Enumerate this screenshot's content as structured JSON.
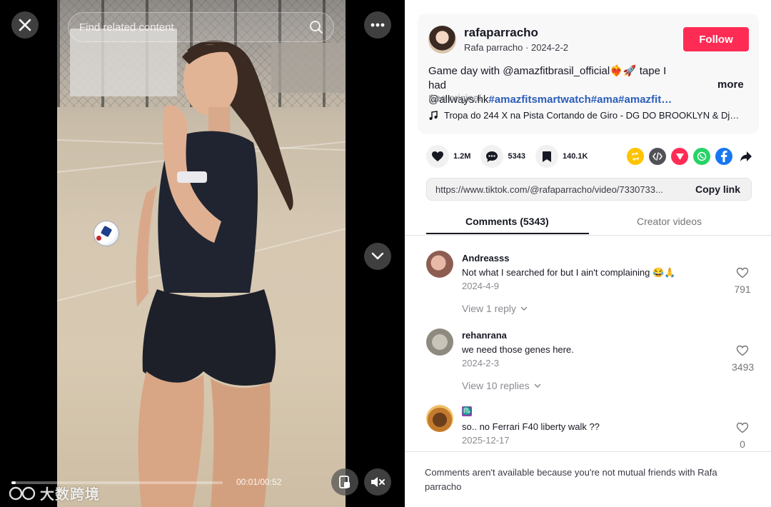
{
  "video": {
    "search_placeholder": "Find related content",
    "time": "00:01/00:52",
    "progress": 0.02,
    "watermark": "大数跨境"
  },
  "post": {
    "username": "rafaparracho",
    "display_name": "Rafa parracho",
    "date": "2024-2-2",
    "follow_label": "Follow",
    "desc_line1": "Game day with @amazfitbrasil_official❤️‍🔥🚀 tape I had",
    "desc_line2_prefix": "@allways.hk",
    "desc_line2_tags": "#amazfitsmartwatch#ama#amazfit…",
    "more_label": "more",
    "see_original": "See original",
    "music": "Tropa do 244 X na Pista Cortando de Giro - DG DO BROOKLYN & Dj…"
  },
  "stats": {
    "likes": "1.2M",
    "comments": "5343",
    "saves": "140.1K"
  },
  "link": {
    "url": "https://www.tiktok.com/@rafaparracho/video/7330733...",
    "copy_label": "Copy link"
  },
  "tabs": {
    "comments": "Comments (5343)",
    "creator": "Creator videos"
  },
  "comments": [
    {
      "name": "Andreasss",
      "text": "Not what I searched for but I ain't complaining 😂🙏",
      "date": "2024-4-9",
      "replies": "View 1 reply",
      "likes": "791"
    },
    {
      "name": "rehanrana",
      "text": "we need those genes here.",
      "date": "2024-2-3",
      "replies": "View 10 replies",
      "likes": "3493"
    },
    {
      "name": "♏",
      "text": "so.. no Ferrari F40 liberty walk ??",
      "date": "2025-12-17",
      "replies": "",
      "likes": "0"
    }
  ],
  "notice": "Comments aren't available because you're not mutual friends with Rafa parracho",
  "colors": {
    "follow": "#fe2c55",
    "hashtag": "#2b5db9",
    "repost": "#ffc300",
    "pinterest_like": "#fe2c55",
    "whatsapp": "#25d366",
    "facebook": "#1877f2"
  },
  "icons": [
    "close-icon",
    "search-icon",
    "more-icon",
    "chevron-down-icon",
    "pip-icon",
    "mute-icon",
    "heart-icon",
    "comment-icon",
    "bookmark-icon",
    "repost-icon",
    "embed-icon",
    "send-icon",
    "whatsapp-icon",
    "facebook-icon",
    "share-arrow-icon",
    "music-note-icon"
  ]
}
